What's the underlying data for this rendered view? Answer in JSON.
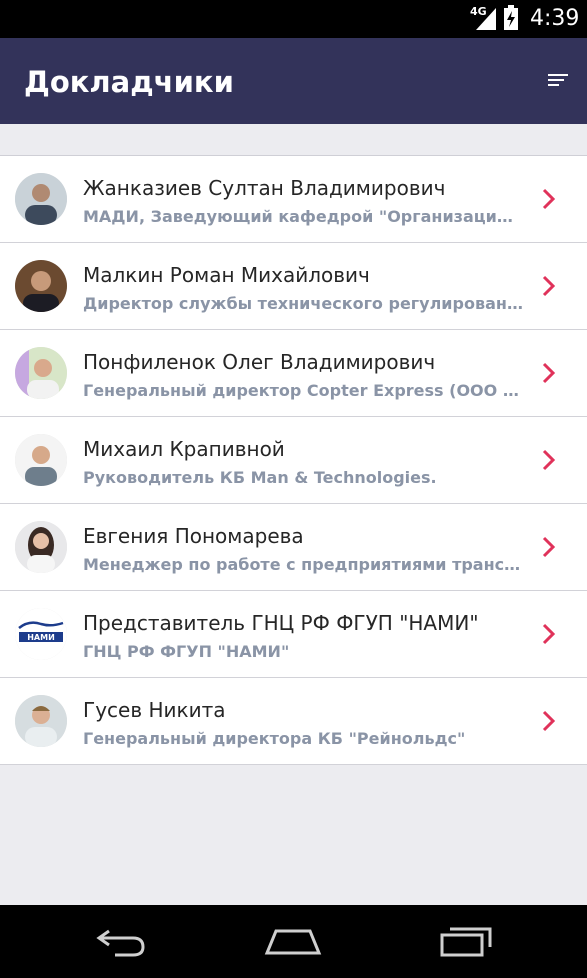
{
  "status_bar": {
    "network": "4G",
    "time": "4:39",
    "icons": [
      "signal-icon",
      "battery-charging-icon"
    ]
  },
  "app_bar": {
    "title": "Докладчики",
    "action_icon": "sort-icon"
  },
  "speakers": [
    {
      "name": "Жанказиев Султан Владимирович",
      "subtitle": "МАДИ, Заведующий кафедрой \"Организация и безопасность движения\""
    },
    {
      "name": "Малкин Роман Михайлович",
      "subtitle": "Директор службы технического регулирования и стандартизации"
    },
    {
      "name": "Понфиленок Олег Владимирович",
      "subtitle": "Генеральный директор  Copter Express (ООО «Коптер Экспресс Технологии»)"
    },
    {
      "name": "Михаил Крапивной",
      "subtitle": "Руководитель КБ Man & Technologies."
    },
    {
      "name": "Евгения Пономарева",
      "subtitle": "Менеджер по работе с предприятиями транспортной отрасли"
    },
    {
      "name": "Представитель ГНЦ РФ ФГУП \"НАМИ\"",
      "subtitle": "ГНЦ РФ ФГУП \"НАМИ\""
    },
    {
      "name": "Гусев Никита",
      "subtitle": "Генеральный директора КБ \"Рейнольдс\""
    }
  ],
  "logo_text": "НАМИ",
  "colors": {
    "app_bar": "#33335a",
    "chevron": "#e0325a",
    "subtitle": "#8a94a6",
    "background": "#ececf0"
  },
  "nav_bar": {
    "icons": [
      "back-icon",
      "home-icon",
      "recents-icon"
    ]
  }
}
